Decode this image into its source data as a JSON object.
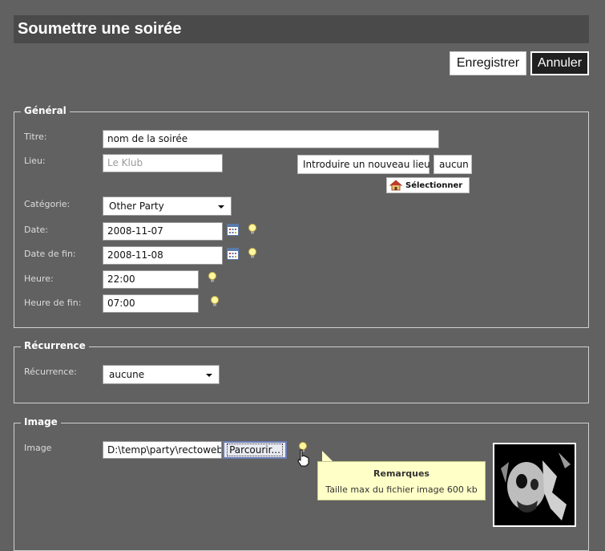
{
  "page": {
    "title": "Soumettre une soirée"
  },
  "toolbar": {
    "save_label": "Enregistrer",
    "cancel_label": "Annuler"
  },
  "general": {
    "legend": "Général",
    "titre": {
      "label": "Titre:",
      "value": "nom de la soirée"
    },
    "lieu": {
      "label": "Lieu:",
      "placeholder": "Le Klub",
      "new_place_label": "Introduire un nouveau lieu",
      "none_label": "aucun",
      "select_label": "Sélectionner"
    },
    "categorie": {
      "label": "Catégorie:",
      "value": "Other Party"
    },
    "date": {
      "label": "Date:",
      "value": "2008-11-07"
    },
    "date_fin": {
      "label": "Date de fin:",
      "value": "2008-11-08"
    },
    "heure": {
      "label": "Heure:",
      "value": "22:00"
    },
    "heure_fin": {
      "label": "Heure de fin:",
      "value": "07:00"
    }
  },
  "recurrence": {
    "legend": "Récurrence",
    "label": "Récurrence:",
    "value": "aucune"
  },
  "image": {
    "legend": "Image",
    "label": "Image",
    "file_value": "D:\\temp\\party\\rectoweb.",
    "browse_label": "Parcourir..."
  },
  "tooltip": {
    "title": "Remarques",
    "text": "Taille max du fichier image 600 kb"
  },
  "icons": {
    "calendar": "calendar-icon",
    "info": "lightbulb-icon",
    "home": "house-icon",
    "cursor": "hand-pointer-icon"
  },
  "colors": {
    "background": "#616161",
    "title_bar": "#4a4a4a",
    "tooltip_bg": "#ffffc8"
  }
}
